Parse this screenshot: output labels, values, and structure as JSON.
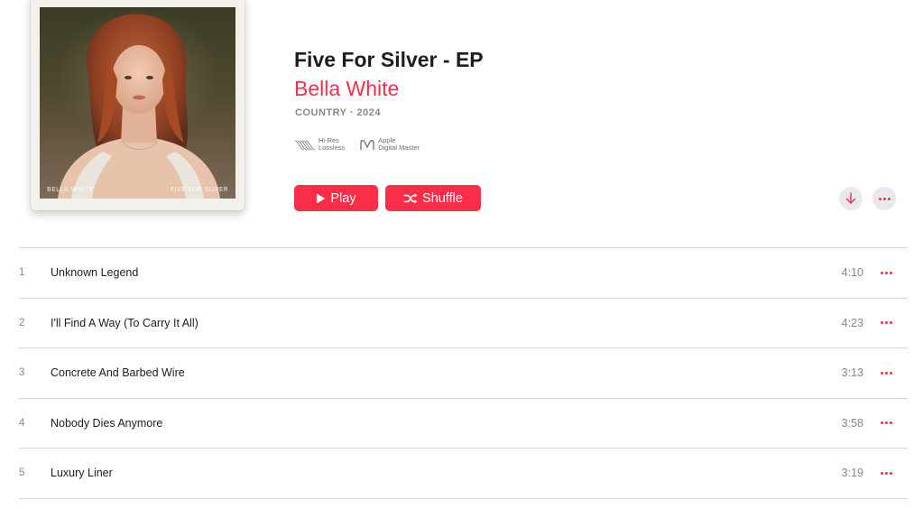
{
  "album": {
    "title": "Five For Silver - EP",
    "artist": "Bella White",
    "meta": "COUNTRY · 2024",
    "cover_caption_left": "BELLA WHITE",
    "cover_caption_right": "FIVE FOR SILVER"
  },
  "badges": [
    {
      "icon": "hi-res-lossless-icon",
      "line1": "Hi-Res",
      "line2": "Lossless"
    },
    {
      "icon": "apple-digital-master-icon",
      "line1": "Apple",
      "line2": "Digital Master"
    }
  ],
  "actions": {
    "play_label": "Play",
    "shuffle_label": "Shuffle"
  },
  "tracks": [
    {
      "number": "1",
      "title": "Unknown Legend",
      "duration": "4:10"
    },
    {
      "number": "2",
      "title": "I'll Find A Way (To Carry It All)",
      "duration": "4:23"
    },
    {
      "number": "3",
      "title": "Concrete And Barbed Wire",
      "duration": "3:13"
    },
    {
      "number": "4",
      "title": "Nobody Dies Anymore",
      "duration": "3:58"
    },
    {
      "number": "5",
      "title": "Luxury Liner",
      "duration": "3:19"
    }
  ],
  "colors": {
    "accent": "#fa2d48",
    "secondary_text": "#86868b"
  }
}
